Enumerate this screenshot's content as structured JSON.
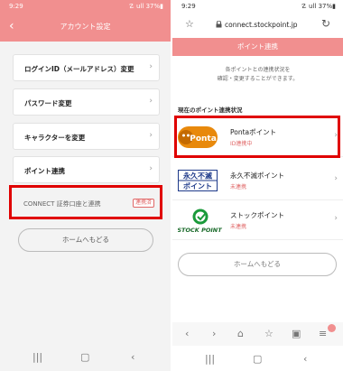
{
  "left": {
    "status": {
      "time": "9:29",
      "indicators": "☡ ull 37%▮"
    },
    "header": {
      "back": "‹",
      "title": "アカウント設定"
    },
    "menu": [
      {
        "label": "ログインID（メールアドレス）変更"
      },
      {
        "label": "パスワード変更"
      },
      {
        "label": "キャラクターを変更"
      },
      {
        "label": "ポイント連携"
      }
    ],
    "chevron": "›",
    "connect": {
      "label": "CONNECT 証券口座と連携",
      "badge": "連携済"
    },
    "home_button": "ホームへもどる",
    "nav": {
      "recents": "|||",
      "home": "▢",
      "back": "‹"
    }
  },
  "right": {
    "status": {
      "time": "9:29",
      "indicators": "☡ ull 37%▮"
    },
    "urlbar": {
      "star": "☆",
      "lock": "🔒",
      "url": "connect.stockpoint.jp",
      "reload": "↻"
    },
    "header": {
      "title": "ポイント連携"
    },
    "description": [
      "各ポイントとの連携状況を",
      "確認・変更することができます。"
    ],
    "section_title": "現在のポイント連携状況",
    "points": [
      {
        "name": "Pontaポイント",
        "status": "ID連携中",
        "logo": "Ponta"
      },
      {
        "name": "永久不滅ポイント",
        "status": "未連携",
        "logo_top": "永久不滅",
        "logo_bottom": "ポイント"
      },
      {
        "name": "ストックポイント",
        "status": "未連携",
        "logo": "STOCK POINT"
      }
    ],
    "chevron": "›",
    "home_button": "ホームへもどる",
    "toolbar": {
      "back": "‹",
      "forward": "›",
      "home": "⌂",
      "bookmark": "☆",
      "tabs": "▣",
      "menu": "≡",
      "tab_count": "1"
    },
    "nav": {
      "recents": "|||",
      "home": "▢",
      "back": "‹"
    }
  },
  "colors": {
    "accent": "#f18f8f",
    "highlight": "#e00000",
    "status_red": "#e06666"
  }
}
